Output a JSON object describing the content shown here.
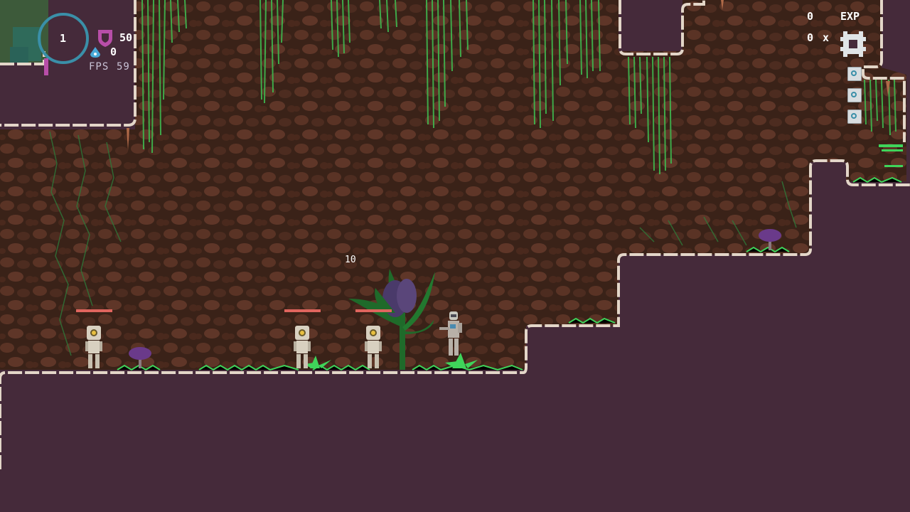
{
  "hud": {
    "level": "1",
    "shield": "50",
    "mana": "0",
    "fps_label": "FPS",
    "fps_value": "59",
    "exp_value": "0",
    "exp_label": "EXP",
    "currency_value": "0",
    "currency_mult": "x"
  },
  "combat": {
    "damage_number": "10"
  },
  "colors": {
    "background_purple": "#452a3a",
    "cave_dirt": "#3a2218",
    "vine_green": "#3fb84f",
    "enemy_health": "#e0655e",
    "level_ring": "#3a8fa8",
    "shield_icon": "#b84ea8",
    "mana_icon": "#48a8d8"
  }
}
